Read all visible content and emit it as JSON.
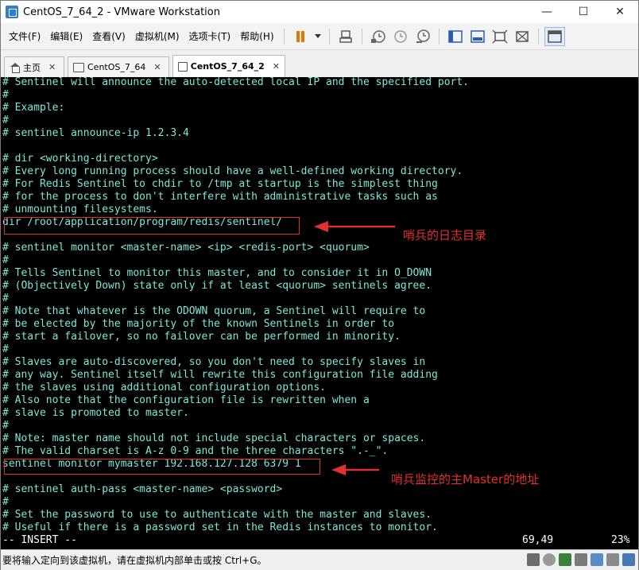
{
  "window": {
    "title": "CentOS_7_64_2 - VMware Workstation"
  },
  "menu": {
    "items": [
      "文件(F)",
      "编辑(E)",
      "查看(V)",
      "虚拟机(M)",
      "选项卡(T)",
      "帮助(H)"
    ]
  },
  "toolbar_icons": [
    "pause-icon",
    "dropdown-icon",
    "send-keys-icon",
    "snapshot-icon",
    "revert-snapshot-icon",
    "snapshot-manager-icon",
    "sidebar-toggle-icon",
    "console-view-icon",
    "fullscreen-icon",
    "unity-icon",
    "library-view-icon"
  ],
  "tabs": [
    {
      "label": "主页",
      "icon": "home-icon",
      "active": false
    },
    {
      "label": "CentOS_7_64",
      "icon": "vm-icon",
      "active": false
    },
    {
      "label": "CentOS_7_64_2",
      "icon": "vm-icon",
      "active": true
    }
  ],
  "terminal": {
    "lines": [
      "# Sentinel will announce the auto-detected local IP and the specified port.",
      "#",
      "# Example:",
      "#",
      "# sentinel announce-ip 1.2.3.4",
      "",
      "# dir <working-directory>",
      "# Every long running process should have a well-defined working directory.",
      "# For Redis Sentinel to chdir to /tmp at startup is the simplest thing",
      "# for the process to don't interfere with administrative tasks such as",
      "# unmounting filesystems.",
      "dir /root/application/program/redis/sentinel/",
      "",
      "# sentinel monitor <master-name> <ip> <redis-port> <quorum>",
      "#",
      "# Tells Sentinel to monitor this master, and to consider it in O_DOWN",
      "# (Objectively Down) state only if at least <quorum> sentinels agree.",
      "#",
      "# Note that whatever is the ODOWN quorum, a Sentinel will require to",
      "# be elected by the majority of the known Sentinels in order to",
      "# start a failover, so no failover can be performed in minority.",
      "#",
      "# Slaves are auto-discovered, so you don't need to specify slaves in",
      "# any way. Sentinel itself will rewrite this configuration file adding",
      "# the slaves using additional configuration options.",
      "# Also note that the configuration file is rewritten when a",
      "# slave is promoted to master.",
      "#",
      "# Note: master name should not include special characters or spaces.",
      "# The valid charset is A-z 0-9 and the three characters \".-_\".",
      "sentinel monitor mymaster 192.168.127.128 6379 1",
      "",
      "# sentinel auth-pass <master-name> <password>",
      "#",
      "# Set the password to use to authenticate with the master and slaves.",
      "# Useful if there is a password set in the Redis instances to monitor."
    ],
    "status_mode": "-- INSERT --",
    "cursor_position": "69,49",
    "scroll_percent": "23%"
  },
  "annotations": [
    {
      "text": "哨兵的日志目录"
    },
    {
      "text": "哨兵监控的主Master的地址"
    }
  ],
  "statusbar": {
    "message": "要将输入定向到该虚拟机，请在虚拟机内部单击或按 Ctrl+G。"
  },
  "colors": {
    "terminal_text": "#7ee8d8",
    "terminal_bg": "#000000",
    "annotation": "#e03030",
    "pause_icon": "#e07a00"
  }
}
